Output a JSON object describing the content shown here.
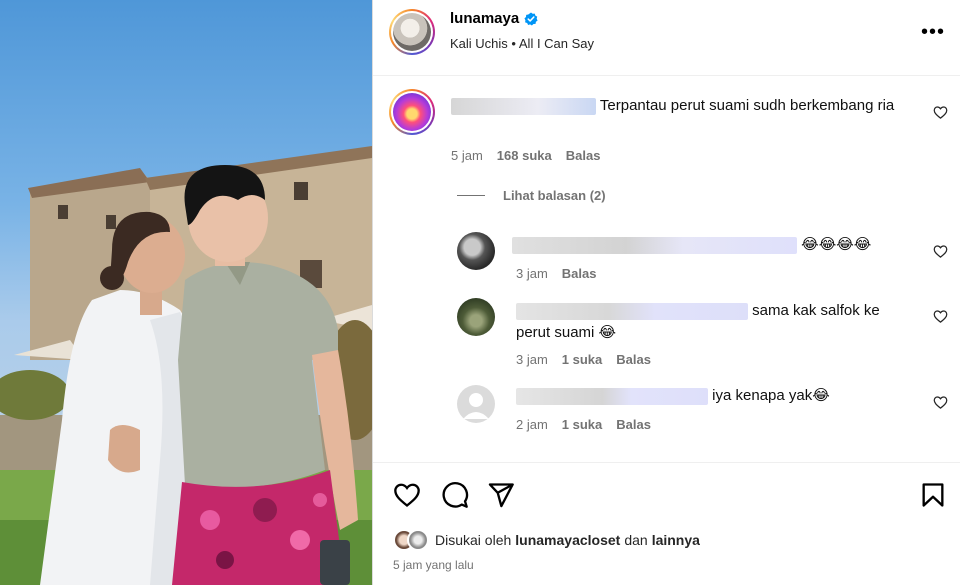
{
  "post": {
    "username": "lunamaya",
    "artist": "Kali Uchis",
    "song": "All I Can Say",
    "separator": "•",
    "more_icon": "more-horizontal-icon"
  },
  "comment": {
    "text": "Terpantau perut suami sudh berkembang ria",
    "time": "5 jam",
    "likes": "168 suka",
    "reply": "Balas",
    "view_replies": "Lihat balasan (2)"
  },
  "replies": [
    {
      "text": "😂😂😂😂",
      "time": "3 jam",
      "likes": "",
      "reply": "Balas"
    },
    {
      "text_line1": "sama kak salfok ke",
      "text_line2": "perut suami 😂",
      "time": "3 jam",
      "likes": "1 suka",
      "reply": "Balas"
    },
    {
      "text": "iya kenapa yak😂",
      "time": "2 jam",
      "likes": "1 suka",
      "reply": "Balas"
    }
  ],
  "footer": {
    "liked_prefix": "Disukai oleh",
    "liked_user": "lunamayacloset",
    "liked_and": "dan",
    "liked_others": "lainnya",
    "time": "5 jam yang lalu"
  },
  "colors": {
    "verified": "#0095f6",
    "muted": "#737373",
    "blur": "#e3e3ef"
  }
}
